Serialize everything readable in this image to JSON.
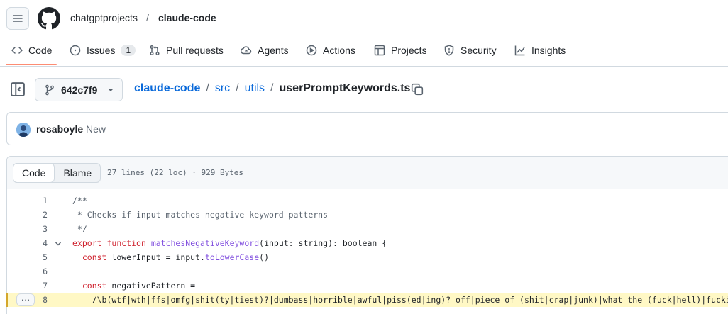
{
  "header": {
    "owner": "chatgptprojects",
    "slash": "/",
    "repo": "claude-code"
  },
  "tabs": [
    {
      "label": "Code",
      "icon": "code-icon",
      "active": true
    },
    {
      "label": "Issues",
      "icon": "issue-icon",
      "count": "1"
    },
    {
      "label": "Pull requests",
      "icon": "pull-request-icon"
    },
    {
      "label": "Agents",
      "icon": "agents-icon"
    },
    {
      "label": "Actions",
      "icon": "play-icon"
    },
    {
      "label": "Projects",
      "icon": "table-icon"
    },
    {
      "label": "Security",
      "icon": "shield-icon"
    },
    {
      "label": "Insights",
      "icon": "graph-icon"
    }
  ],
  "file_nav": {
    "branch": "642c7f9",
    "path": [
      "claude-code",
      "src",
      "utils"
    ],
    "separator": "/",
    "file_name": "userPromptKeywords.ts"
  },
  "commit": {
    "author": "rosaboyle",
    "message": "New"
  },
  "viewer": {
    "code_tab": "Code",
    "blame_tab": "Blame",
    "meta": "27 lines (22 loc) · 929 Bytes"
  },
  "code_lines": [
    {
      "n": "1",
      "parts": [
        [
          "c-cm",
          "/**"
        ]
      ]
    },
    {
      "n": "2",
      "parts": [
        [
          "c-cm",
          " * Checks if input matches negative keyword patterns"
        ]
      ]
    },
    {
      "n": "3",
      "parts": [
        [
          "c-cm",
          " */"
        ]
      ]
    },
    {
      "n": "4",
      "fold": true,
      "parts": [
        [
          "c-kw",
          "export"
        ],
        [
          "c-pl",
          " "
        ],
        [
          "c-kw",
          "function"
        ],
        [
          "c-pl",
          " "
        ],
        [
          "c-fn",
          "matchesNegativeKeyword"
        ],
        [
          "c-pl",
          "(input: string): boolean {"
        ]
      ]
    },
    {
      "n": "5",
      "parts": [
        [
          "c-pl",
          "  "
        ],
        [
          "c-kw",
          "const"
        ],
        [
          "c-pl",
          " lowerInput = input."
        ],
        [
          "c-fn",
          "toLowerCase"
        ],
        [
          "c-pl",
          "()"
        ]
      ]
    },
    {
      "n": "6",
      "parts": [
        [
          "c-pl",
          ""
        ]
      ]
    },
    {
      "n": "7",
      "parts": [
        [
          "c-pl",
          "  "
        ],
        [
          "c-kw",
          "const"
        ],
        [
          "c-pl",
          " negativePattern ="
        ]
      ]
    },
    {
      "n": "8",
      "highlight": true,
      "parts": [
        [
          "c-pl",
          "    /\\b(wtf|wth|ffs|omfg|shit(ty|tiest)?|dumbass|horrible|awful|piss(ed|ing)? off|piece of (shit|crap|junk)|what the (fuck|hell)|fucking? (b"
        ]
      ]
    }
  ],
  "colors": {
    "accent": "#0969da",
    "tab_underline": "#fd8c73",
    "highlight": "#fff8c5"
  }
}
